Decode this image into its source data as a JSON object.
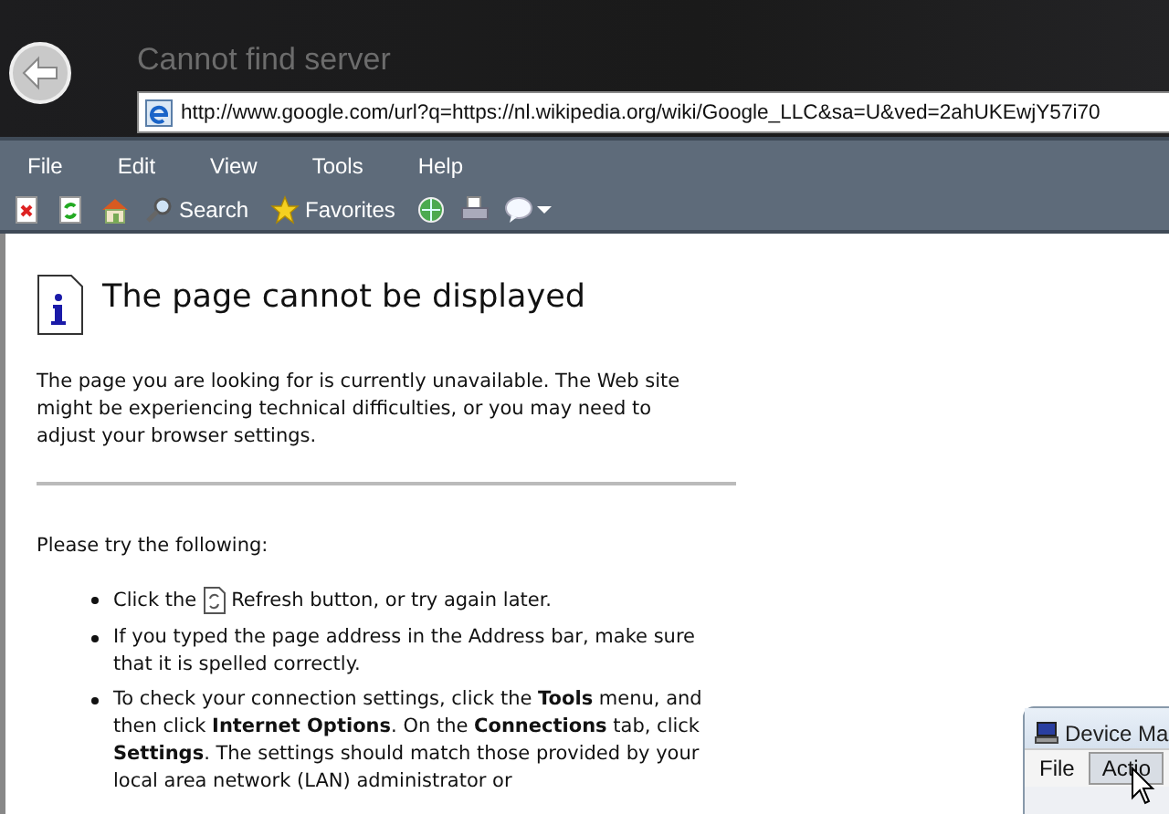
{
  "window": {
    "title": "Cannot find server",
    "address": "http://www.google.com/url?q=https://nl.wikipedia.org/wiki/Google_LLC&sa=U&ved=2ahUKEwjY57i70"
  },
  "menu": [
    "File",
    "Edit",
    "View",
    "Tools",
    "Help"
  ],
  "toolbar": [
    {
      "kind": "stop"
    },
    {
      "kind": "refresh"
    },
    {
      "kind": "home"
    },
    {
      "kind": "search",
      "label": "Search"
    },
    {
      "kind": "favorites",
      "label": "Favorites"
    },
    {
      "kind": "media"
    },
    {
      "kind": "print"
    },
    {
      "kind": "discuss"
    }
  ],
  "page": {
    "heading": "The page cannot be displayed",
    "intro": "The page you are looking for is currently unavailable. The Web site might be experiencing technical difficulties, or you may need to adjust your browser settings.",
    "try_heading": "Please try the following:",
    "bullets": [
      {
        "kind": "icon_text",
        "before": "Click the",
        "after": "Refresh button, or try again later."
      },
      {
        "kind": "text",
        "text": "If you typed the page address in the Address bar, make sure that it is spelled correctly."
      },
      {
        "kind": "text",
        "text": "To check your connection settings, click the **Tools** menu, and then click **Internet Options**. On the **Connections** tab, click **Settings**. The settings should match those provided by your local area network (LAN) administrator or"
      }
    ]
  },
  "device_window": {
    "title": "Device Ma",
    "menu": [
      {
        "label": "File",
        "selected": false
      },
      {
        "label": "Actio",
        "selected": true
      }
    ]
  }
}
